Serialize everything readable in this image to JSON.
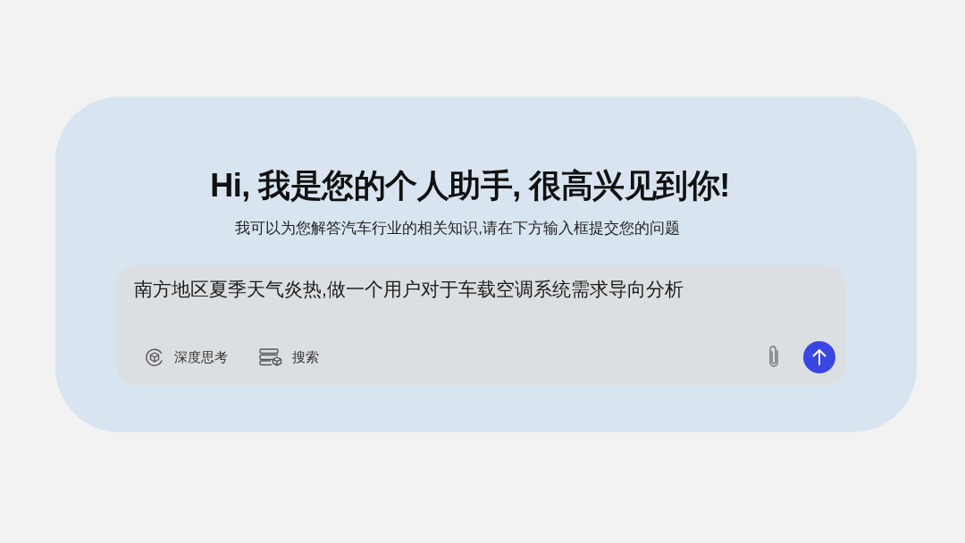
{
  "welcome_panel": {
    "heading": "Hi, 我是您的个人助手, 很高兴见到你!",
    "subtitle": "我可以为您解答汽车行业的相关知识,请在下方输入框提交您的问题",
    "composer": {
      "input": {
        "value": "南方地区夏季天气炎热,做一个用户对于车载空调系统需求导向分析"
      },
      "tools": [
        {
          "kind": "deep_think",
          "label": "深度思考"
        },
        {
          "kind": "search",
          "label": "搜索"
        }
      ],
      "actions": [
        {
          "kind": "attach"
        },
        {
          "kind": "send"
        }
      ]
    }
  }
}
